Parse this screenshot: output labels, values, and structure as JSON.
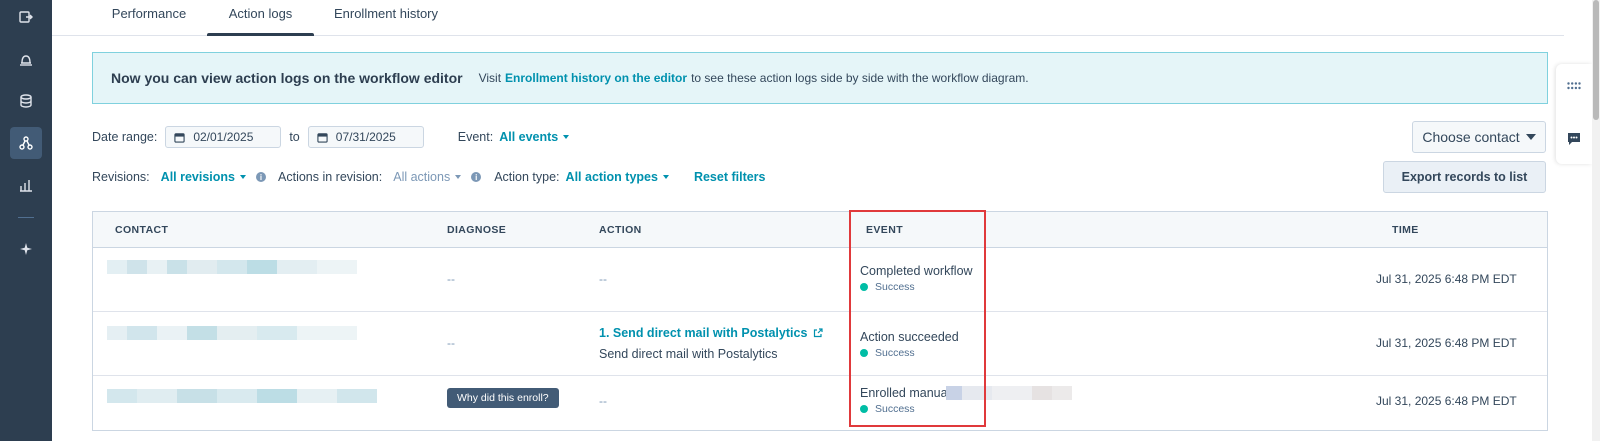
{
  "tabs": [
    {
      "label": "Performance"
    },
    {
      "label": "Action logs"
    },
    {
      "label": "Enrollment history"
    }
  ],
  "banner": {
    "title": "Now you can view action logs on the workflow editor",
    "text_before": "Visit",
    "link": "Enrollment history on the editor",
    "text_after": "to see these action logs side by side with the workflow diagram."
  },
  "filters": {
    "date_range_label": "Date range:",
    "date_from": "02/01/2025",
    "to_label": "to",
    "date_to": "07/31/2025",
    "event_label": "Event:",
    "event_value": "All events",
    "revisions_label": "Revisions:",
    "revisions_value": "All revisions",
    "actions_label": "Actions in revision:",
    "actions_value": "All actions",
    "action_type_label": "Action type:",
    "action_type_value": "All action types",
    "reset": "Reset filters"
  },
  "buttons": {
    "choose_contact": "Choose contact",
    "export": "Export records to list"
  },
  "table": {
    "headers": {
      "contact": "CONTACT",
      "diagnose": "DIAGNOSE",
      "action": "ACTION",
      "event": "EVENT",
      "time": "TIME"
    },
    "rows": [
      {
        "diagnose": "--",
        "action": "--",
        "event": "Completed workflow",
        "status": "Success",
        "time": "Jul 31, 2025 6:48 PM EDT"
      },
      {
        "diagnose": "--",
        "action_link": "1. Send direct mail with Postalytics",
        "action_sub": "Send direct mail with Postalytics",
        "event": "Action succeeded",
        "status": "Success",
        "time": "Jul 31, 2025 6:48 PM EDT"
      },
      {
        "diagnose_button": "Why did this enroll?",
        "action": "--",
        "event": "Enrolled manually",
        "status": "Success",
        "time": "Jul 31, 2025 6:48 PM EDT"
      }
    ]
  },
  "colors": {
    "rail": "#2d3e50",
    "link": "#0091ae",
    "success": "#00bda5",
    "highlight": "#e0393b",
    "banner_bg": "#e5f5f8"
  }
}
